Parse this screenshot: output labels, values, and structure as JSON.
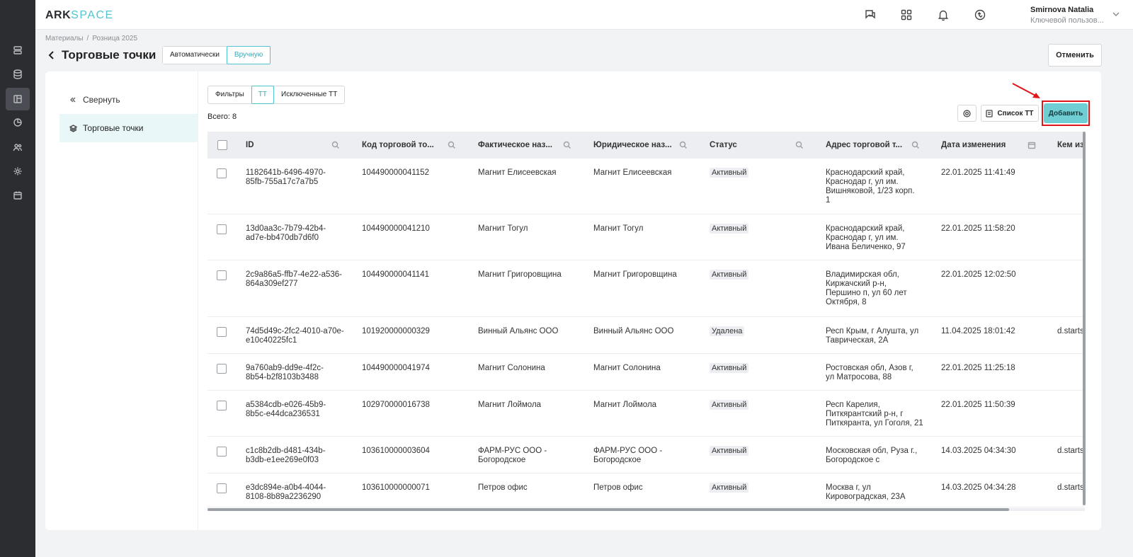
{
  "app": {
    "logo_a": "ARK",
    "logo_b": "SPACE"
  },
  "user": {
    "name": "Smirnova Natalia",
    "role": "Ключевой пользов..."
  },
  "breadcrumb": {
    "root": "Материалы",
    "current": "Розница 2025"
  },
  "page": {
    "title": "Торговые точки",
    "mode_auto": "Автоматически",
    "mode_manual": "Вручную",
    "cancel_label": "Отменить"
  },
  "sidebar": {
    "collapse_label": "Свернуть",
    "item_label": "Торговые точки"
  },
  "filters": {
    "filters_label": "Фильтры",
    "tt_label": "ТТ",
    "excluded_label": "Исключенные ТТ"
  },
  "toolbar": {
    "total_label": "Всего: 8",
    "list_label": "Список ТТ",
    "add_label": "Добавить"
  },
  "table": {
    "headers": {
      "id": "ID",
      "code": "Код торговой то...",
      "fact_name": "Фактическое наз...",
      "legal_name": "Юридическое наз...",
      "status": "Статус",
      "address": "Адрес торговой т...",
      "date": "Дата изменения",
      "author": "Кем из"
    },
    "rows": [
      {
        "id1": "1182641b-6496-4970-",
        "id2": "85fb-755a17c7a7b5",
        "code": "104490000041152",
        "fact1": "Магнит Елисеевская",
        "fact2": "",
        "legal1": "Магнит Елисеевская",
        "legal2": "",
        "status": "Активный",
        "addr1": "Краснодарский край,",
        "addr2": "Краснодар г, ул им.",
        "addr3": "Вишняковой, 1/23 корп.",
        "addr4": "1",
        "date": "22.01.2025 11:41:49",
        "author": ""
      },
      {
        "id1": "13d0aa3c-7b79-42b4-",
        "id2": "ad7e-bb470db7d6f0",
        "code": "104490000041210",
        "fact1": "Магнит Тогул",
        "fact2": "",
        "legal1": "Магнит Тогул",
        "legal2": "",
        "status": "Активный",
        "addr1": "Краснодарский край,",
        "addr2": "Краснодар г, ул им.",
        "addr3": "Ивана Беличенко, 97",
        "addr4": "",
        "date": "22.01.2025 11:58:20",
        "author": ""
      },
      {
        "id1": "2c9a86a5-ffb7-4e22-a536-",
        "id2": "864a309ef277",
        "code": "104490000041141",
        "fact1": "Магнит Григоровщина",
        "fact2": "",
        "legal1": "Магнит Григоровщина",
        "legal2": "",
        "status": "Активный",
        "addr1": "Владимирская обл,",
        "addr2": "Киржачский р-н,",
        "addr3": "Першино п, ул 60 лет",
        "addr4": "Октября, 8",
        "date": "22.01.2025 12:02:50",
        "author": ""
      },
      {
        "id1": "74d5d49c-2fc2-4010-a70e-",
        "id2": "e10c40225fc1",
        "code": "101920000000329",
        "fact1": "Винный Альянс ООО",
        "fact2": "",
        "legal1": "Винный Альянс ООО",
        "legal2": "",
        "status": "Удалена",
        "addr1": "Респ Крым, г Алушта, ул",
        "addr2": "Таврическая, 2А",
        "addr3": "",
        "addr4": "",
        "date": "11.04.2025 18:01:42",
        "author": "d.starts"
      },
      {
        "id1": "9a760ab9-dd9e-4f2c-",
        "id2": "8b54-b2f8103b3488",
        "code": "104490000041974",
        "fact1": "Магнит Солонина",
        "fact2": "",
        "legal1": "Магнит Солонина",
        "legal2": "",
        "status": "Активный",
        "addr1": "Ростовская обл, Азов г,",
        "addr2": "ул Матросова, 88",
        "addr3": "",
        "addr4": "",
        "date": "22.01.2025 11:25:18",
        "author": ""
      },
      {
        "id1": "a5384cdb-e026-45b9-",
        "id2": "8b5c-e44dca236531",
        "code": "102970000016738",
        "fact1": "Магнит Лоймола",
        "fact2": "",
        "legal1": "Магнит Лоймола",
        "legal2": "",
        "status": "Активный",
        "addr1": "Респ Карелия,",
        "addr2": "Питкярантский р-н, г",
        "addr3": "Питкяранта, ул Гоголя, 21",
        "addr4": "",
        "date": "22.01.2025 11:50:39",
        "author": ""
      },
      {
        "id1": "c1c8b2db-d481-434b-",
        "id2": "b3db-e1ee269e0f03",
        "code": "103610000003604",
        "fact1": "ФАРМ-РУС ООО -",
        "fact2": "Богородское",
        "legal1": "ФАРМ-РУС ООО -",
        "legal2": "Богородское",
        "status": "Активный",
        "addr1": "Московская обл, Руза г.,",
        "addr2": "Богородское с",
        "addr3": "",
        "addr4": "",
        "date": "14.03.2025 04:34:30",
        "author": "d.starts"
      },
      {
        "id1": "e3dc894e-a0b4-4044-",
        "id2": "8108-8b89a2236290",
        "code": "103610000000071",
        "fact1": "Петров офис",
        "fact2": "",
        "legal1": "Петров офис",
        "legal2": "",
        "status": "Активный",
        "addr1": "Москва г, ул",
        "addr2": "Кировоградская, 23А",
        "addr3": "",
        "addr4": "",
        "date": "14.03.2025 04:34:28",
        "author": "d.starts"
      }
    ]
  }
}
